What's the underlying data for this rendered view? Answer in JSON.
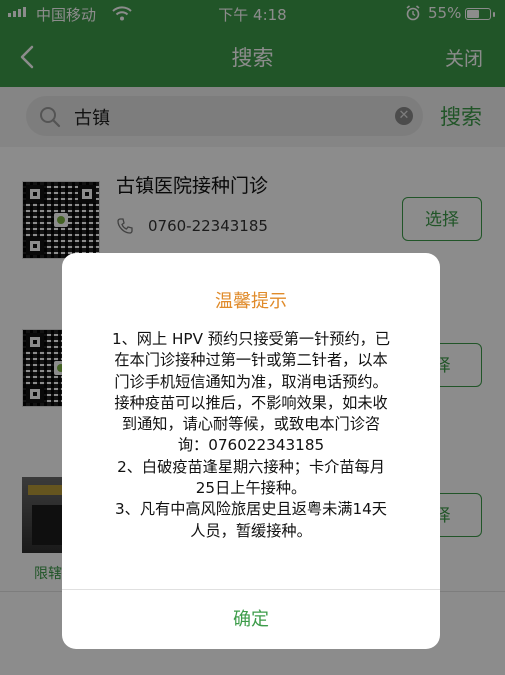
{
  "status_bar": {
    "carrier": "中国移动",
    "time": "下午 4:18",
    "battery_percent": "55%",
    "battery_level": 0.55,
    "icons": [
      "signal-icon",
      "wifi-icon",
      "alarm-icon",
      "battery-icon"
    ]
  },
  "nav": {
    "back_icon": "back-chevron-icon",
    "title": "搜索",
    "close_label": "关闭"
  },
  "search": {
    "value": "古镇",
    "button_label": "搜索",
    "clear_icon": "clear-icon"
  },
  "results": [
    {
      "name": "古镇医院接种门诊",
      "phone": "0760-22343185",
      "button": "选择"
    },
    {
      "button": "择"
    },
    {
      "button": "择",
      "label": "限辖"
    }
  ],
  "dialog": {
    "title": "温馨提示",
    "lines": [
      "1、网上 HPV 预约只接受第一针预约，已",
      "在本门诊接种过第一针或第二针者，以本",
      "门诊手机短信通知为准，取消电话预约。",
      "接种疫苗可以推后，不影响效果，如未收",
      "到通知，请心耐等候，或致电本门诊咨",
      "询：076022343185",
      "2、白破疫苗逢星期六接种；卡介苗每月",
      "25日上午接种。",
      "3、凡有中高风险旅居史且返粤未满14天",
      "人员，暂缓接种。"
    ],
    "confirm_label": "确定"
  },
  "colors": {
    "brand_green": "#3d9c4a",
    "dialog_title": "#e08b2a"
  }
}
